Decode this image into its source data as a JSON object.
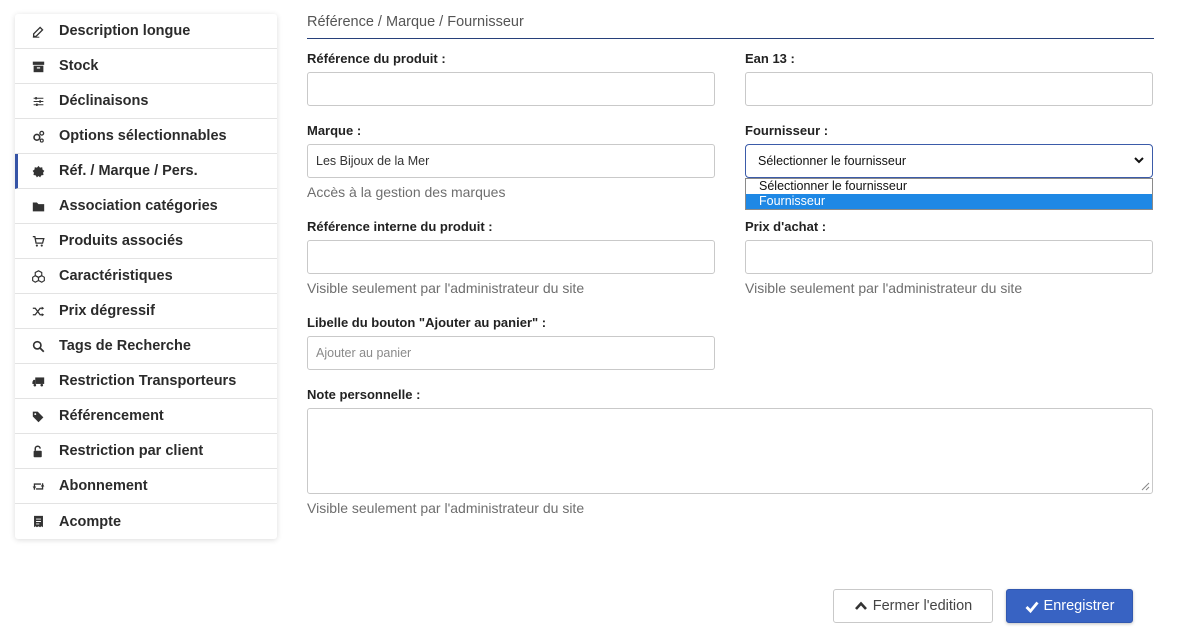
{
  "sidebar": {
    "items": [
      {
        "label": "Description longue",
        "icon": "edit-icon"
      },
      {
        "label": "Stock",
        "icon": "archive-icon"
      },
      {
        "label": "Déclinaisons",
        "icon": "sliders-icon"
      },
      {
        "label": "Options sélectionnables",
        "icon": "cogs-icon"
      },
      {
        "label": "Réf. / Marque / Pers.",
        "icon": "certificate-icon",
        "active": true
      },
      {
        "label": "Association catégories",
        "icon": "folder-icon"
      },
      {
        "label": "Produits associés",
        "icon": "cart-icon"
      },
      {
        "label": "Caractéristiques",
        "icon": "cubes-icon"
      },
      {
        "label": "Prix dégressif",
        "icon": "random-icon"
      },
      {
        "label": "Tags de Recherche",
        "icon": "search-icon"
      },
      {
        "label": "Restriction Transporteurs",
        "icon": "truck-icon"
      },
      {
        "label": "Référencement",
        "icon": "tags-icon"
      },
      {
        "label": "Restriction par client",
        "icon": "unlock-icon"
      },
      {
        "label": "Abonnement",
        "icon": "retweet-icon"
      },
      {
        "label": "Acompte",
        "icon": "receipt-icon"
      }
    ]
  },
  "main": {
    "section_title": "Référence / Marque / Fournisseur",
    "reference": {
      "label": "Référence du produit :",
      "value": ""
    },
    "ean": {
      "label": "Ean 13 :",
      "value": ""
    },
    "marque": {
      "label": "Marque :",
      "value": "Les Bijoux de la Mer",
      "help": "Accès à la gestion des marques"
    },
    "fournisseur": {
      "label": "Fournisseur :",
      "selected": "Sélectionner le fournisseur",
      "options": [
        "Sélectionner le fournisseur",
        "Fournisseur"
      ],
      "highlighted": "Fournisseur"
    },
    "ref_interne": {
      "label": "Référence interne du produit :",
      "value": "",
      "help": "Visible seulement par l'administrateur du site"
    },
    "prix_achat": {
      "label": "Prix d'achat :",
      "value": "",
      "help": "Visible seulement par l'administrateur du site"
    },
    "libelle_bouton": {
      "label": "Libelle du bouton \"Ajouter au panier\" :",
      "placeholder": "Ajouter au panier"
    },
    "note": {
      "label": "Note personnelle :",
      "value": "",
      "help": "Visible seulement par l'administrateur du site"
    }
  },
  "footer": {
    "close_label": "Fermer l'edition",
    "save_label": "Enregistrer"
  },
  "colors": {
    "accent": "#3863c3",
    "active_border": "#3654a6",
    "dropdown_highlight": "#1e88e5"
  }
}
